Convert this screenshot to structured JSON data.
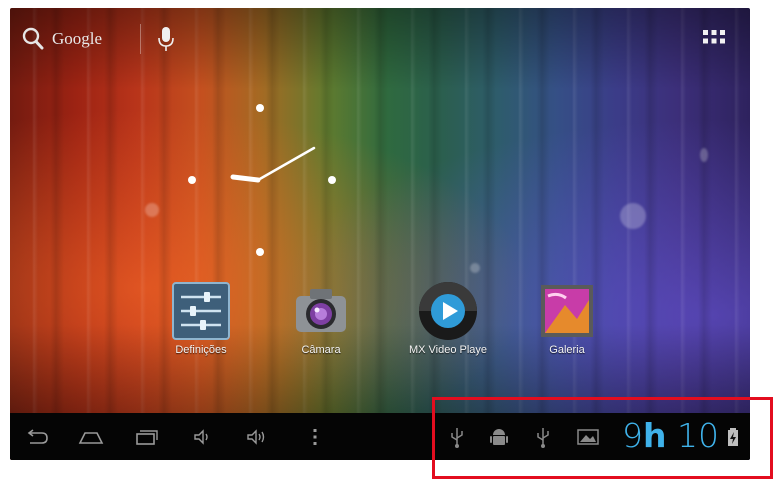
{
  "search": {
    "label": "Google"
  },
  "apps": [
    {
      "label": "Definições",
      "icon": "settings-icon"
    },
    {
      "label": "Câmara",
      "icon": "camera-icon"
    },
    {
      "label": "MX Video Playe",
      "icon": "play-icon"
    },
    {
      "label": "Galeria",
      "icon": "gallery-icon"
    }
  ],
  "statusbar": {
    "clock_hours": "9",
    "clock_separator": "h",
    "clock_minutes": "10",
    "icons": [
      "usb-icon",
      "android-debug-icon",
      "usb-icon",
      "image-notification-icon",
      "battery-charging-icon"
    ]
  },
  "navbar": {
    "buttons": [
      "back-icon",
      "home-icon",
      "recent-apps-icon",
      "volume-down-icon",
      "volume-up-icon",
      "menu-icon"
    ]
  },
  "colors": {
    "accent": "#3fb2ea",
    "highlight": "#e30d1f",
    "navbar_bg": "#050505"
  }
}
